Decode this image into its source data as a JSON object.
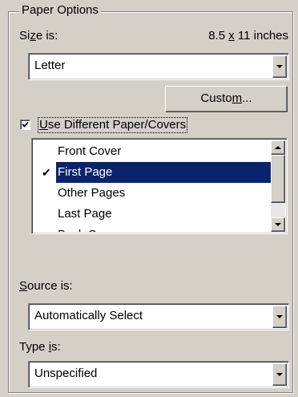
{
  "paper_options": {
    "group_title": "Paper Options",
    "size_label": "Size is:",
    "size_dimensions": "8.5 x 11 inches",
    "size_value": "Letter",
    "custom_button": "Custom...",
    "use_different_paper": {
      "label": "Use Different Paper/Covers",
      "checked": true
    },
    "pages_list": [
      {
        "label": "Front Cover",
        "checked": false,
        "selected": false
      },
      {
        "label": "First Page",
        "checked": true,
        "selected": true
      },
      {
        "label": "Other Pages",
        "checked": false,
        "selected": false
      },
      {
        "label": "Last Page",
        "checked": false,
        "selected": false
      },
      {
        "label": "Back Cover",
        "checked": false,
        "selected": false
      }
    ],
    "source_label": "Source is:",
    "source_value": "Automatically Select",
    "type_label": "Type is:",
    "type_value": "Unspecified"
  },
  "colors": {
    "face": "#d4d0c8",
    "selection": "#0a246a"
  }
}
